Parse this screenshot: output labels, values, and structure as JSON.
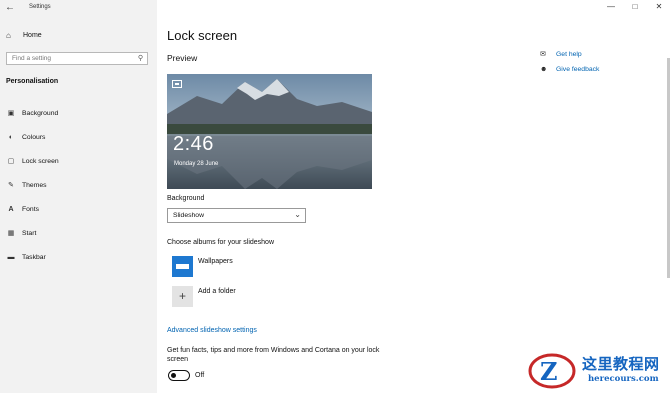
{
  "app": {
    "title": "Settings"
  },
  "sidebar": {
    "home_label": "Home",
    "search_placeholder": "Find a setting",
    "section_title": "Personalisation",
    "items": [
      {
        "label": "Background",
        "icon": "picture-icon"
      },
      {
        "label": "Colours",
        "icon": "palette-icon"
      },
      {
        "label": "Lock screen",
        "icon": "lock-screen-icon"
      },
      {
        "label": "Themes",
        "icon": "brush-icon"
      },
      {
        "label": "Fonts",
        "icon": "font-icon"
      },
      {
        "label": "Start",
        "icon": "start-icon"
      },
      {
        "label": "Taskbar",
        "icon": "taskbar-icon"
      }
    ]
  },
  "main": {
    "page_title": "Lock screen",
    "preview_title": "Preview",
    "preview": {
      "time": "2:46",
      "date": "Monday 28 June"
    },
    "background_label": "Background",
    "background_value": "Slideshow",
    "albums_label": "Choose albums for your slideshow",
    "album_name": "Wallpapers",
    "add_folder_label": "Add a folder",
    "advanced_link": "Advanced slideshow settings",
    "fun_facts_text": "Get fun facts, tips and more from Windows and Cortana on your lock screen",
    "toggle_state": "Off"
  },
  "help": {
    "get_help": "Get help",
    "give_feedback": "Give feedback"
  },
  "watermark": {
    "line1": "这里教程网",
    "line2": "herecours.com"
  },
  "colors": {
    "accent": "#0063b1",
    "album_tile": "#1e78d0",
    "sidebar_bg": "#f2f2f2"
  }
}
